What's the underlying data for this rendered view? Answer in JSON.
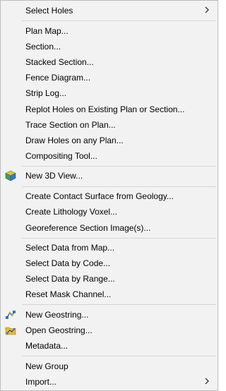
{
  "menu": {
    "groups": [
      [
        {
          "label": "Select Holes",
          "submenu": true
        }
      ],
      [
        {
          "label": "Plan Map..."
        },
        {
          "label": "Section..."
        },
        {
          "label": "Stacked Section..."
        },
        {
          "label": "Fence Diagram..."
        },
        {
          "label": "Strip Log..."
        },
        {
          "label": "Replot Holes on Existing Plan or Section..."
        },
        {
          "label": "Trace Section on Plan..."
        },
        {
          "label": "Draw Holes on any Plan..."
        },
        {
          "label": "Compositing Tool..."
        }
      ],
      [
        {
          "label": "New 3D View...",
          "icon": "3d-view-icon"
        }
      ],
      [
        {
          "label": "Create Contact Surface from Geology..."
        },
        {
          "label": "Create Lithology Voxel..."
        },
        {
          "label": "Georeference Section Image(s)..."
        }
      ],
      [
        {
          "label": "Select Data from Map..."
        },
        {
          "label": "Select Data by Code..."
        },
        {
          "label": "Select Data by Range..."
        },
        {
          "label": "Reset Mask Channel..."
        }
      ],
      [
        {
          "label": "New Geostring...",
          "icon": "new-geostring-icon"
        },
        {
          "label": "Open Geostring...",
          "icon": "open-geostring-icon"
        },
        {
          "label": "Metadata..."
        }
      ],
      [
        {
          "label": "New Group"
        },
        {
          "label": "Import...",
          "submenu": true
        }
      ]
    ]
  }
}
